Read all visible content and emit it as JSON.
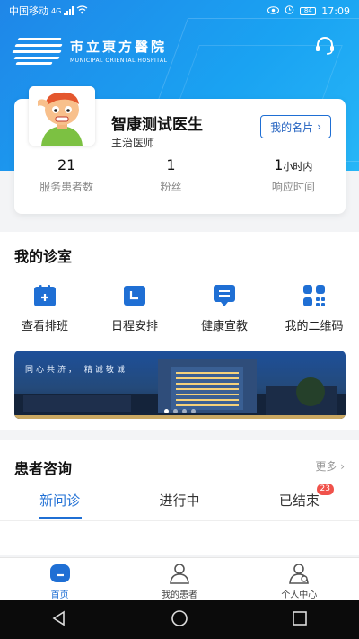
{
  "status_bar": {
    "carrier": "中国移动",
    "network": "4G",
    "battery": "84",
    "time": "17:09"
  },
  "hospital": {
    "name_cn": "市立東方醫院",
    "name_en": "MUNICIPAL ORIENTAL HOSPITAL"
  },
  "doctor": {
    "name": "智康测试医生",
    "title": "主治医师",
    "card_button": "我的名片",
    "stats": [
      {
        "value": "21",
        "unit": "",
        "label": "服务患者数"
      },
      {
        "value": "1",
        "unit": "",
        "label": "粉丝"
      },
      {
        "value": "1",
        "unit": "小时内",
        "label": "响应时间"
      }
    ]
  },
  "clinic": {
    "title": "我的诊室",
    "tools": [
      {
        "label": "查看排班",
        "icon": "schedule-icon"
      },
      {
        "label": "日程安排",
        "icon": "calendar-icon"
      },
      {
        "label": "健康宣教",
        "icon": "health-education-icon"
      },
      {
        "label": "我的二维码",
        "icon": "qrcode-icon"
      }
    ],
    "banner_slogan": "同心共济， 精诚敬诚"
  },
  "consult": {
    "title": "患者咨询",
    "more": "更多",
    "tabs": [
      {
        "label": "新问诊",
        "active": true,
        "badge": ""
      },
      {
        "label": "进行中",
        "active": false,
        "badge": ""
      },
      {
        "label": "已结束",
        "active": false,
        "badge": "23"
      }
    ]
  },
  "bottom_nav": [
    {
      "label": "首页",
      "icon": "home-icon",
      "active": true
    },
    {
      "label": "我的患者",
      "icon": "patients-icon",
      "active": false
    },
    {
      "label": "个人中心",
      "icon": "profile-icon",
      "active": false
    }
  ],
  "colors": {
    "primary": "#1f6fd4",
    "header_start": "#1f86e8",
    "header_end": "#27b6f7",
    "badge": "#f0524b"
  }
}
